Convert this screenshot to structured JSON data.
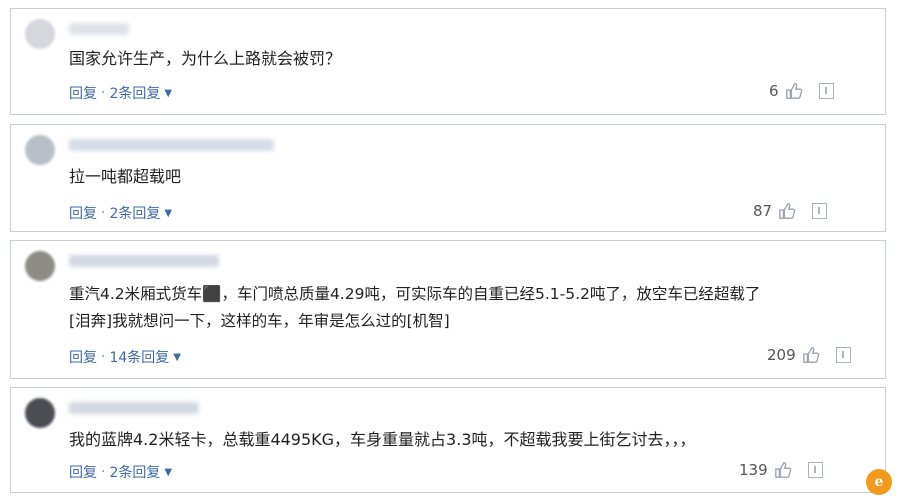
{
  "comments": [
    {
      "text_lines": [
        "国家允许生产，为什么上路就会被罚？"
      ],
      "reply_label": "回复",
      "replies_label": "2条回复",
      "likes": "6"
    },
    {
      "text_lines": [
        "拉一吨都超载吧"
      ],
      "reply_label": "回复",
      "replies_label": "2条回复",
      "likes": "87"
    },
    {
      "text_lines": [
        "重汽4.2米厢式货车⬛，车门喷总质量4.29吨，可实际车的自重已经5.1-5.2吨了，放空车已经超载了",
        "[泪奔]我就想问一下，这样的车，年审是怎么过的[机智]"
      ],
      "reply_label": "回复",
      "replies_label": "14条回复",
      "likes": "209"
    },
    {
      "text_lines": [
        "我的蓝牌4.2米轻卡，总载重4495KG，车身重量就占3.3吨，不超载我要上街乞讨去，，，"
      ],
      "reply_label": "回复",
      "replies_label": "2条回复",
      "likes": "139"
    }
  ],
  "separator": "·",
  "icons": {
    "like": "thumbs-up-icon",
    "report": "report-icon",
    "expand": "chevron-down-icon",
    "watermark": "site-logo-icon"
  },
  "colors": {
    "link": "#3f6aa6",
    "border": "#c9cfd8",
    "text": "#222222"
  }
}
